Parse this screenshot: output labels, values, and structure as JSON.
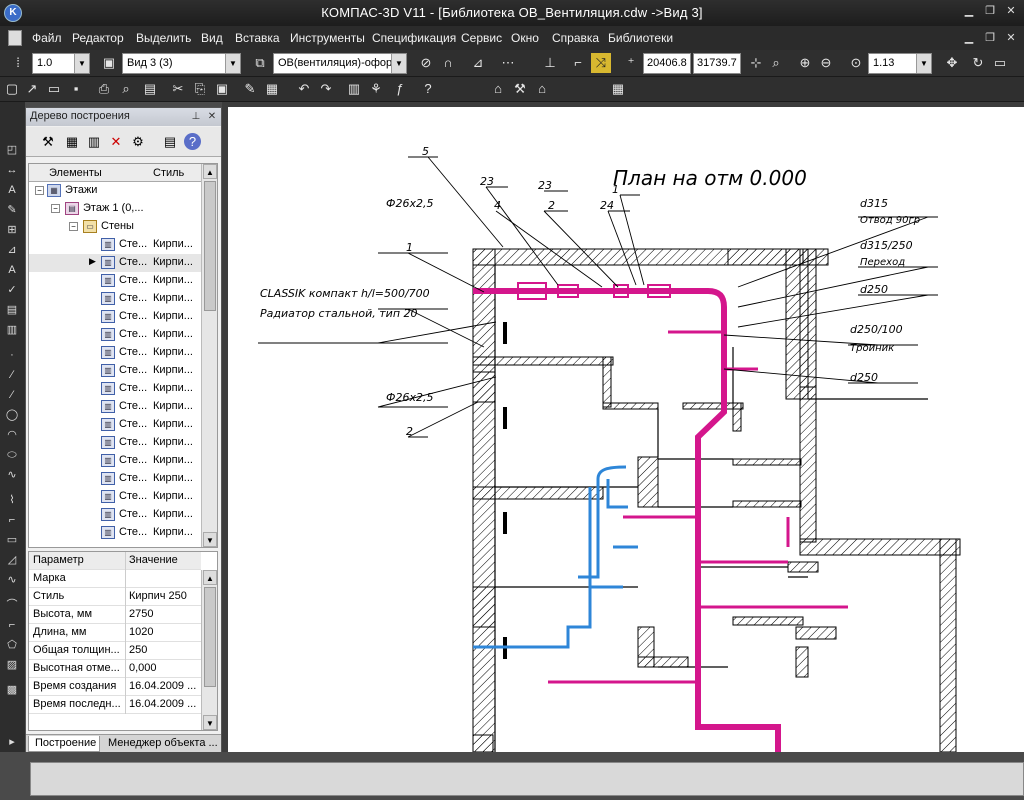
{
  "window": {
    "app_title": "КОМПАС-3D V11",
    "doc_title": "[Библиотека ОВ_Вентиляция.cdw ->Вид 3]"
  },
  "menu": [
    "Файл",
    "Редактор",
    "Выделить",
    "Вид",
    "Вставка",
    "Инструменты",
    "Спецификация",
    "Сервис",
    "Окно",
    "Справка",
    "Библиотеки"
  ],
  "toolbar": {
    "scale": "1.0",
    "view": "Вид 3 (3)",
    "layer": "ОВ(вентиляция)-офор",
    "coord_x": "20406.8",
    "coord_y": "31739.7",
    "zoom": "1.13"
  },
  "tree_panel": {
    "title": "Дерево построения",
    "col_elements": "Элементы",
    "col_style": "Стиль",
    "root": "Этажи",
    "floor": "Этаж 1 (0,...",
    "walls": "Стены",
    "wall_items": [
      {
        "name": "Сте...",
        "style": "Кирпи..."
      },
      {
        "name": "Сте...",
        "style": "Кирпи..."
      },
      {
        "name": "Сте...",
        "style": "Кирпи..."
      },
      {
        "name": "Сте...",
        "style": "Кирпи..."
      },
      {
        "name": "Сте...",
        "style": "Кирпи..."
      },
      {
        "name": "Сте...",
        "style": "Кирпи..."
      },
      {
        "name": "Сте...",
        "style": "Кирпи..."
      },
      {
        "name": "Сте...",
        "style": "Кирпи..."
      },
      {
        "name": "Сте...",
        "style": "Кирпи..."
      },
      {
        "name": "Сте...",
        "style": "Кирпи..."
      },
      {
        "name": "Сте...",
        "style": "Кирпи..."
      },
      {
        "name": "Сте...",
        "style": "Кирпи..."
      },
      {
        "name": "Сте...",
        "style": "Кирпи..."
      },
      {
        "name": "Сте...",
        "style": "Кирпи..."
      },
      {
        "name": "Сте...",
        "style": "Кирпи..."
      },
      {
        "name": "Сте...",
        "style": "Кирпи..."
      },
      {
        "name": "Сте...",
        "style": "Кирпи..."
      }
    ]
  },
  "props": {
    "col_param": "Параметр",
    "col_value": "Значение",
    "rows": [
      {
        "name": "Марка",
        "value": ""
      },
      {
        "name": "Стиль",
        "value": "Кирпич 250"
      },
      {
        "name": "Высота, мм",
        "value": "2750"
      },
      {
        "name": "Длина, мм",
        "value": "1020"
      },
      {
        "name": "Общая толщин...",
        "value": "250"
      },
      {
        "name": "Высотная отме...",
        "value": "0,000"
      },
      {
        "name": "Время создания",
        "value": "16.04.2009 ..."
      },
      {
        "name": "Время последн...",
        "value": "16.04.2009 ..."
      }
    ]
  },
  "tabs": [
    "Построение",
    "Менеджер объекта ..."
  ],
  "drawing": {
    "title": "План на отм 0.000",
    "labels": {
      "l5": "5",
      "l23a": "23",
      "l23b": "23",
      "l4": "4",
      "l2a": "2",
      "l24": "24",
      "l1a": "1",
      "phi1": "Ф26х2,5",
      "l1b": "1",
      "classik": "CLASSIK компакт h/l=500/700",
      "radiator": "Радиатор стальной, тип 20",
      "phi2": "Ф26х2,5",
      "l2b": "2",
      "d315": "d315",
      "otvod": "Отвод 90гр",
      "d315_250": "d315/250",
      "perekhod": "Переход",
      "d250a": "d250",
      "d250_100": "d250/100",
      "troinik": "Тройник",
      "d250b": "d250"
    },
    "colors": {
      "duct": "#d4168c",
      "pipe": "#2e86d8",
      "wall": "#000000"
    }
  }
}
